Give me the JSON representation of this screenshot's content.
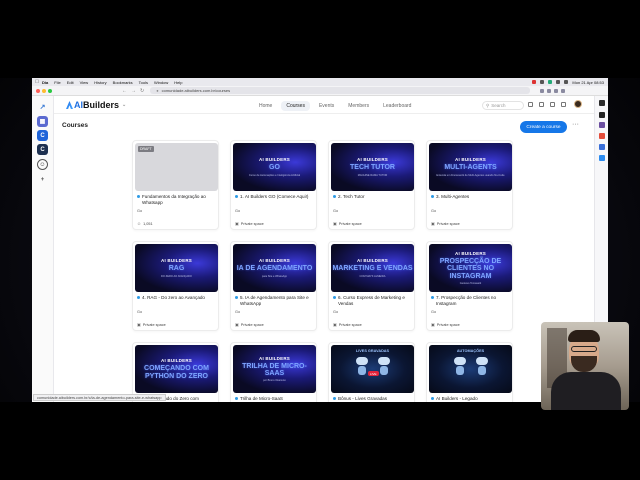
{
  "menubar": {
    "items": [
      "Dia",
      "File",
      "Edit",
      "View",
      "History",
      "Bookmarks",
      "Tools",
      "Window",
      "Help"
    ],
    "clock": "Mon 21 Apr 08:53"
  },
  "browser": {
    "url": "comunidade.aibuilders.com.br/courses"
  },
  "header": {
    "logo_ai": "AI",
    "logo_builders": "Builders",
    "tabs": [
      "Home",
      "Courses",
      "Events",
      "Members",
      "Leaderboard"
    ],
    "active_tab": "Courses",
    "search_placeholder": "Search"
  },
  "page": {
    "title": "Courses",
    "create_label": "Create a course",
    "more_label": "···"
  },
  "cards": [
    {
      "cover_type": "grey",
      "badge": "DRAFT",
      "title": "Fundamentos da Integração ao Whatsapp",
      "author": "Go",
      "footer": "1,051",
      "footer_icon": "members-icon"
    },
    {
      "cover_type": "brand",
      "cover_top": "AI BUILDERS",
      "cover_big": "GO",
      "cover_sub": "Curso de Automações e Inteligência Artificial",
      "title": "1. AI Builders GO (Comece Aqui!)",
      "author": "Go",
      "footer": "Private space",
      "footer_icon": "lock-icon"
    },
    {
      "cover_type": "brand",
      "cover_top": "AI BUILDERS",
      "cover_big": "TECH TUTOR",
      "cover_sub": "MACHINE RAMA TUTOR",
      "title": "2. Tech Tutor",
      "author": "Go",
      "footer": "Private space",
      "footer_icon": "lock-icon"
    },
    {
      "cover_type": "brand",
      "cover_top": "AI BUILDERS",
      "cover_big": "MULTI-AGENTS",
      "cover_sub": "Entenda um Framework de Multi-Agentes usando No-Code",
      "title": "3. Multi-Agentes",
      "author": "Go",
      "footer": "Private space",
      "footer_icon": "lock-icon"
    },
    {
      "cover_type": "brand",
      "cover_top": "AI BUILDERS",
      "cover_big": "RAG",
      "cover_sub": "DO ZERO AO AVANÇADO",
      "title": "4. RAG - Do zero ao Avançado",
      "author": "Go",
      "footer": "Private space",
      "footer_icon": "lock-icon"
    },
    {
      "cover_type": "brand",
      "cover_top": "AI BUILDERS",
      "cover_big": "IA DE AGENDAMENTO",
      "cover_sub": "para Site e WhatsApp",
      "title": "5. IA de Agendamento para Site e WhatsApp",
      "author": "Go",
      "footer": "Private space",
      "footer_icon": "lock-icon"
    },
    {
      "cover_type": "brand",
      "cover_top": "AI BUILDERS",
      "cover_big": "MARKETING E VENDAS",
      "cover_sub": "COM MAYK ALMEIDA",
      "title": "6. Curso Express de Marketing e Vendas",
      "author": "Go",
      "footer": "Private space",
      "footer_icon": "lock-icon"
    },
    {
      "cover_type": "brand",
      "cover_top": "AI BUILDERS",
      "cover_big": "PROSPECÇÃO DE CLIENTES NO INSTAGRAM",
      "cover_sub": "Gustavo Tomasetti",
      "title": "7. Prospecção de Clientes no Instagram",
      "author": "Go",
      "footer": "Private space",
      "footer_icon": "lock-icon"
    },
    {
      "cover_type": "brand",
      "cover_top": "AI BUILDERS",
      "cover_big": "COMEÇANDO COM PYTHON DO ZERO",
      "cover_sub": "",
      "title": "8. Começando do Zero com",
      "author": "",
      "footer": "",
      "footer_icon": ""
    },
    {
      "cover_type": "brand",
      "cover_top": "AI BUILDERS",
      "cover_big": "TRILHA DE MICRO-SAAS",
      "cover_sub": "por Bruno Okamoto",
      "title": "Trilha de Micro-SaaS",
      "author": "",
      "footer": "",
      "footer_icon": ""
    },
    {
      "cover_type": "robots",
      "cover_top": "LIVES GRAVADAS",
      "cover_big": "",
      "cover_sub": "",
      "live": "LIVE",
      "title": "Bônus - Lives Gravadas",
      "author": "",
      "footer": "",
      "footer_icon": ""
    },
    {
      "cover_type": "robots",
      "cover_top": "AUTOMAÇÕES",
      "cover_big": "",
      "cover_sub": "",
      "title": "AI Builders - Legado",
      "author": "",
      "footer": "",
      "footer_icon": ""
    }
  ],
  "status_url": "comunidade.aibuilders.com.br/c/ia-de-agendamento-para-site-e-whatsapp",
  "colors": {
    "brand_blue": "#1677e8",
    "dot_blue": "#2e9be6",
    "cover_accent": "#7ea4ff"
  }
}
